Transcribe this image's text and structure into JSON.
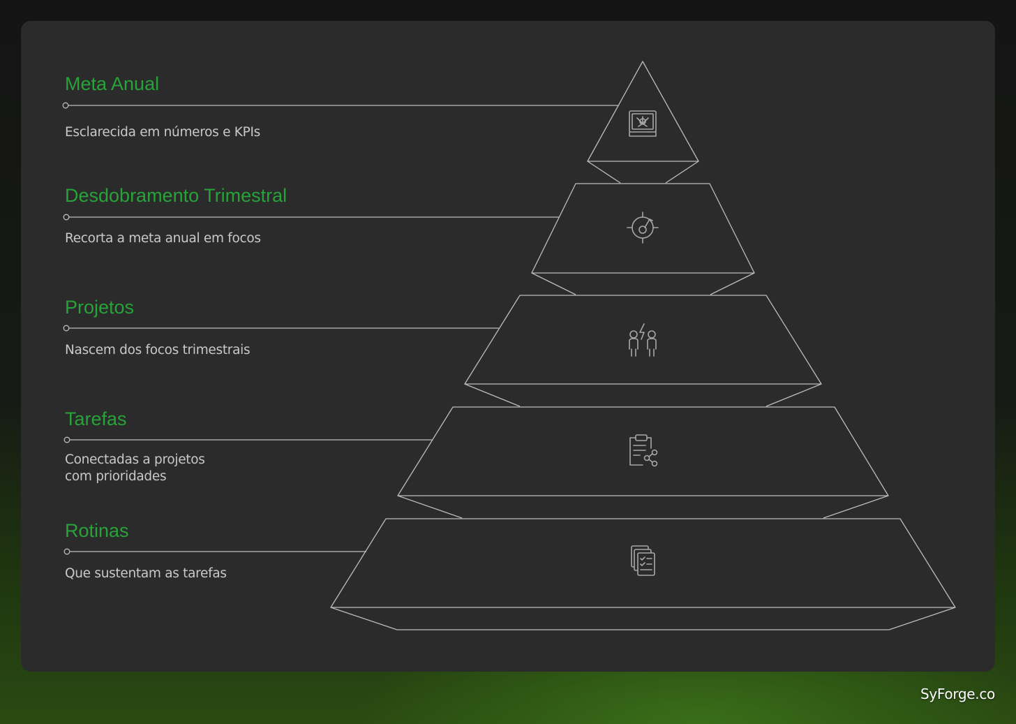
{
  "levels": [
    {
      "title": "Meta Anual",
      "description": "Esclarecida em números e KPIs",
      "icon": "certificate-icon"
    },
    {
      "title": "Desdobramento Trimestral",
      "description": "Recorta a meta anual em focos",
      "icon": "target-icon"
    },
    {
      "title": "Projetos",
      "description": "Nascem dos focos trimestrais",
      "icon": "team-energy-icon"
    },
    {
      "title": "Tarefas",
      "description": "Conectadas a projetos\ncom prioridades",
      "icon": "clipboard-share-icon"
    },
    {
      "title": "Rotinas",
      "description": "Que sustentam as tarefas",
      "icon": "document-checklist-icon"
    }
  ],
  "brand": "SyForge.co",
  "colors": {
    "title": "#27a339",
    "description": "#c9c9c9",
    "card": "#2b2b2b",
    "outline": "#bdbdbd",
    "icon": "#a8a8a8"
  }
}
